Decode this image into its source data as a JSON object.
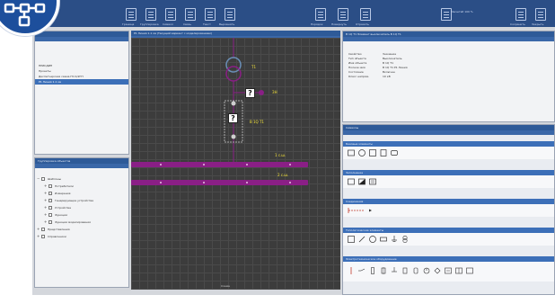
{
  "ribbon": {
    "groups": [
      "Граница",
      "Группировка",
      "Символ",
      "Связь",
      "Текст",
      "Выровнять",
      "Порядок",
      "Повернуть",
      "Отразить"
    ],
    "right_labels": [
      "Масштаб 100 %",
      "Сохранить",
      "Закрыть"
    ]
  },
  "left_top_panel": {
    "items": [
      "ПРИСДИП",
      "Проекты",
      "Диспетчерская схема ПЧ 4/2ГП",
      "Р1 Линия 1.1 кв"
    ],
    "selected_index": 3
  },
  "left_bottom_panel": {
    "title": "Группировка объектов",
    "tree": [
      {
        "label": "Шаблоны",
        "expanded": true
      },
      {
        "label": "Потребители",
        "expanded": false
      },
      {
        "label": "Измерения",
        "expanded": false
      },
      {
        "label": "Генерирующие устройства",
        "expanded": false
      },
      {
        "label": "Устройства",
        "expanded": false
      },
      {
        "label": "Функции",
        "expanded": false
      },
      {
        "label": "Функции моделирования",
        "expanded": false
      },
      {
        "label": "Представления",
        "expanded": false
      },
      {
        "label": "Справочники",
        "expanded": false
      }
    ]
  },
  "canvas": {
    "title": "Р1 Линия 1.1 кв (Текущий вариант с моделированием)",
    "labels": [
      "Т1",
      "ЗН",
      "В 1Q Т1",
      "1 с.ш.",
      "2 с.ш."
    ],
    "footer": "Схема"
  },
  "properties_panel": {
    "title": "В 1Q Т1 Элемент выключатель В 1Q Т1",
    "header_key": "Свойство",
    "header_value": "Значение",
    "rows": [
      {
        "k": "Тип объекта",
        "v": "Выключатель"
      },
      {
        "k": "Имя объекта",
        "v": "В 1Q Т1"
      },
      {
        "k": "Полное имя",
        "v": "В 1Q Т1 Р1 Линия"
      },
      {
        "k": "Состояние",
        "v": "Включен"
      },
      {
        "k": "Класс напряж.",
        "v": "10 кВ"
      }
    ]
  },
  "library_panel": {
    "title": "Символы",
    "sections": [
      "Базовые элементы",
      "Заполнение",
      "Соединения",
      "Топологические элементы",
      "Электротехническое оборудование"
    ]
  },
  "colors": {
    "ribbon": "#2b4e86",
    "panel_title": "#2e5a98",
    "canvas": "#3c3c3c",
    "busbar": "#8a1f86",
    "label": "#f3e23a"
  }
}
